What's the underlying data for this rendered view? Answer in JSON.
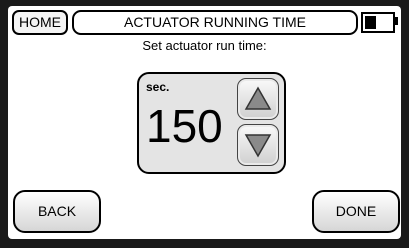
{
  "header": {
    "home_label": "HOME",
    "title": "ACTUATOR RUNNING TIME",
    "battery_icon": "battery-icon"
  },
  "main": {
    "prompt": "Set actuator run time:",
    "unit": "sec.",
    "value": "150",
    "increment_icon": "triangle-up-icon",
    "decrement_icon": "triangle-down-icon"
  },
  "footer": {
    "back_label": "BACK",
    "done_label": "DONE"
  },
  "colors": {
    "background": "#1a1a1a",
    "panel": "#ffffff",
    "spinner_bg": "#e4e4e4",
    "arrow_fill": "#8a8a8a"
  }
}
